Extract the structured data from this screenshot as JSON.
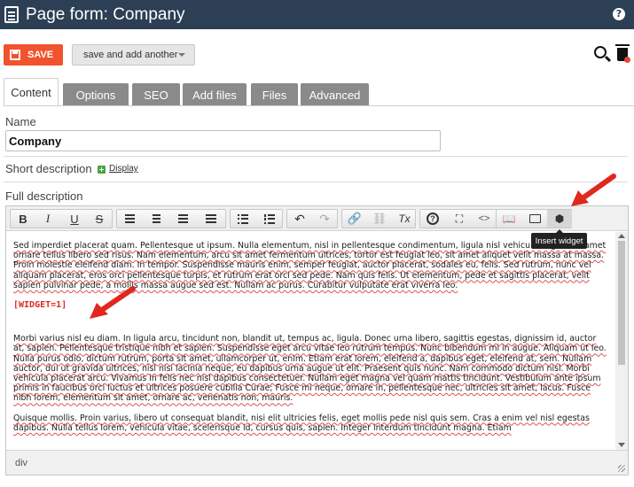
{
  "header": {
    "title": "Page form: Company",
    "help_label": "?"
  },
  "actions": {
    "save_label": "SAVE",
    "save_another_label": "save and add another"
  },
  "tabs": [
    {
      "label": "Content",
      "active": true
    },
    {
      "label": "Options"
    },
    {
      "label": "SEO"
    },
    {
      "label": "Add files"
    },
    {
      "label": "Files"
    },
    {
      "label": "Advanced"
    }
  ],
  "form": {
    "name_label": "Name",
    "name_value": "Company",
    "short_desc_label": "Short description",
    "display_label": "Display",
    "full_desc_label": "Full description"
  },
  "editor": {
    "toolbar": {
      "bold": "B",
      "italic": "I",
      "underline": "U",
      "strike": "S",
      "clear_format": "Tx",
      "source": "<>"
    },
    "tooltip": "Insert widget",
    "paragraph1": "Sed imperdiet placerat quam. Pellentesque ut ipsum. Nulla elementum, nisl in pellentesque condimentum, ligula nisl vehicula augue, sit amet ornare tellus libero sed risus. Nam elementum, arcu sit amet fermentum ultrices, tortor est feugiat leo, sit amet aliquet velit massa at massa. Proin molestie eleifend diam. In tempor. Suspendisse mauris enim, semper feugiat, auctor placerat, sodales eu, felis. Sed rutrum, nunc vel aliquam placerat, eros orci pellentesque turpis, et rutrum erat orci sed pede. Nam quis felis. Ut elementum, pede et sagittis placerat, velit sapien pulvinar pede, a mollis massa augue sed est. Nullam ac purus. Curabitur vulputate erat viverra leo.",
    "widget_tag": "[WIDGET=1]",
    "paragraph2": "Morbi varius nisl eu diam. In ligula arcu, tincidunt non, blandit ut, tempus ac, ligula. Donec urna libero, sagittis egestas, dignissim id, auctor at, sapien. Pellentesque tristique nibh et sapien. Suspendisse eget arcu vitae leo rutrum tempus. Nunc bibendum mi in augue. Aliquam ut leo. Nulla purus odio, dictum rutrum, porta sit amet, ullamcorper ut, enim. Etiam erat lorem, eleifend a, dapibus eget, eleifend at, sem. Nullam auctor, dui ut gravida ultrices, nisl nisi lacinia neque, eu dapibus urna augue ut elit. Praesent quis nunc. Nam commodo dictum nisl. Morbi vehicula placerat arcu. Vivamus in felis nec nisl dapibus consectetuer. Nullam eget magna vel quam mattis tincidunt. Vestibulum ante ipsum primis in faucibus orci luctus et ultrices posuere cubilia Curae; Fusce mi neque, ornare in, pellentesque nec, ultricies sit amet, lacus. Fusce nibh lorem, elementum sit amet, ornare ac, venenatis non, mauris.",
    "paragraph3": "Quisque mollis. Proin varius, libero ut consequat blandit, nisi elit ultricies felis, eget mollis pede nisl quis sem. Cras a enim vel nisl egestas dapibus. Nulla tellus lorem, vehicula vitae, scelerisque id, cursus quis, sapien. Integer interdum tincidunt magna. Etiam",
    "status_path": "div"
  },
  "colors": {
    "header_bg": "#2c3f55",
    "save_bg": "#f0532e",
    "annotation_arrow": "#e0281f",
    "widget_text": "#e0281f"
  }
}
